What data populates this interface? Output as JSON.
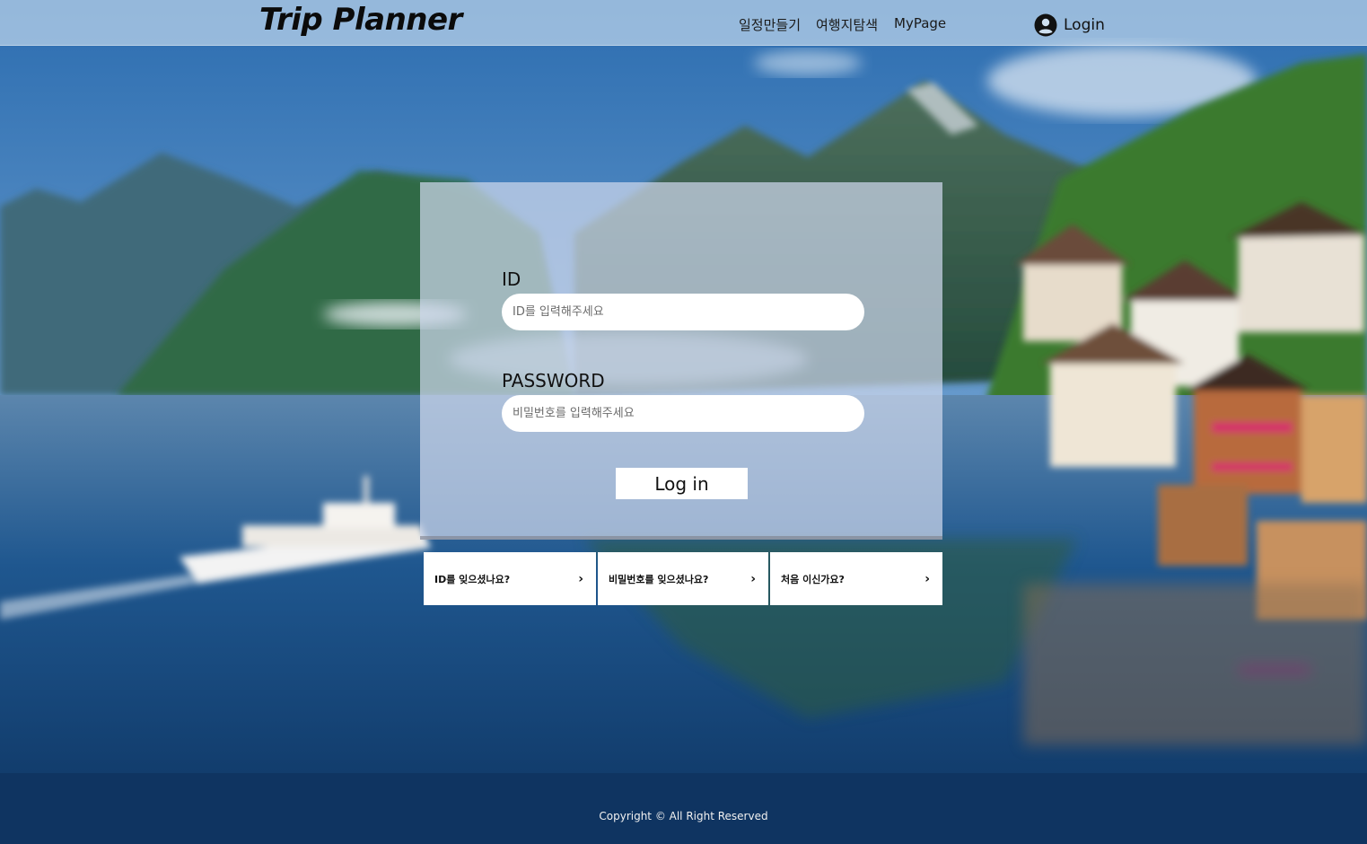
{
  "header": {
    "brand": "Trip Planner",
    "nav": [
      "일정만들기",
      "여행지탐색",
      "MyPage"
    ],
    "login_label": "Login"
  },
  "login_form": {
    "id_label": "ID",
    "id_placeholder": "ID를 입력해주세요",
    "id_value": "",
    "password_label": "PASSWORD",
    "password_placeholder": "비밀번호를 입력해주세요",
    "password_value": "",
    "submit_label": "Log in"
  },
  "help_links": [
    {
      "label": "ID를 잊으셨나요?",
      "icon": "chevron-right-icon"
    },
    {
      "label": "비밀번호를 잊으셨나요?",
      "icon": "chevron-right-icon"
    },
    {
      "label": "처음 이신가요?",
      "icon": "chevron-right-icon"
    }
  ],
  "footer": {
    "copyright": "Copyright © All Right Reserved"
  },
  "colors": {
    "header_bg": "#bed6ec",
    "footer_bg": "#0f3461",
    "panel_bg": "#cdd7eb",
    "text": "#111111"
  }
}
